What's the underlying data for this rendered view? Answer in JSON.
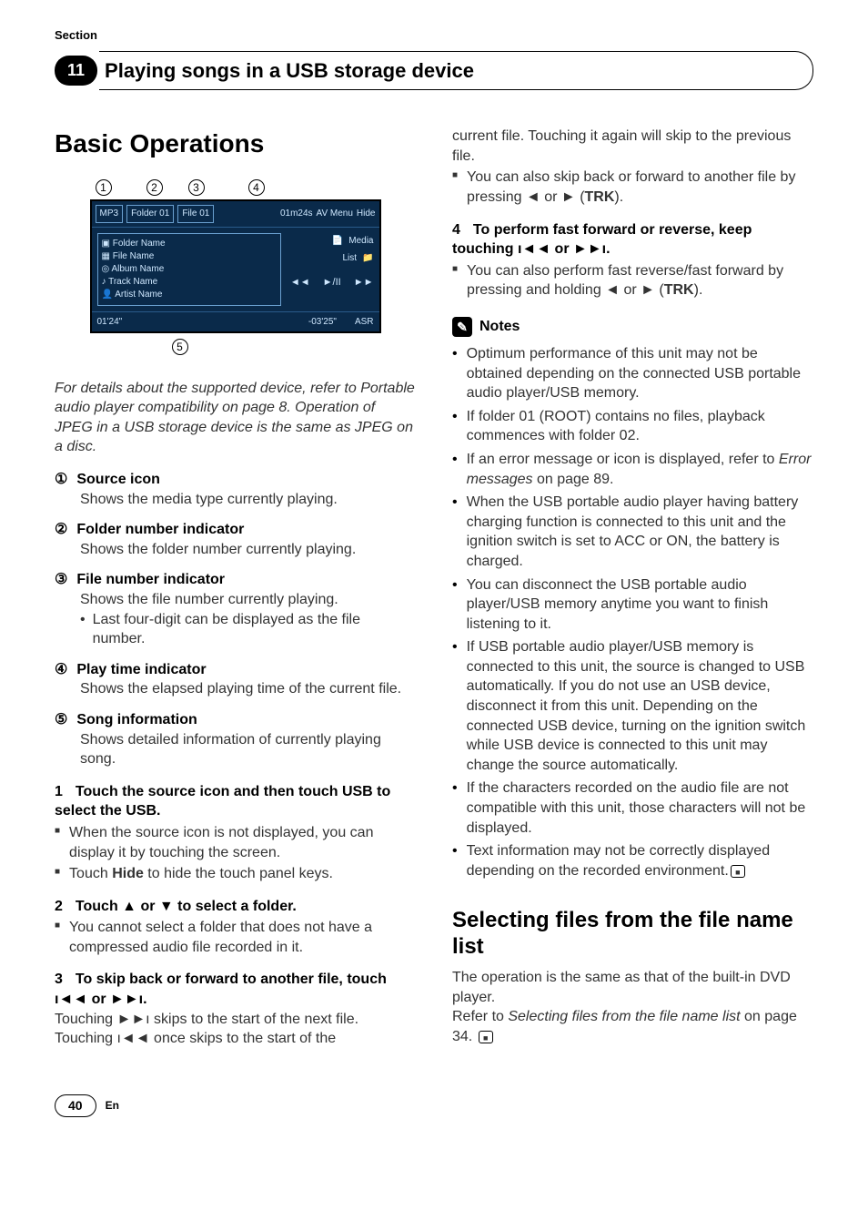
{
  "header": {
    "section_label": "Section",
    "chapter_number": "11",
    "chapter_title": "Playing songs in a USB storage device"
  },
  "left": {
    "h1": "Basic Operations",
    "screenshot": {
      "callouts_top": [
        "1",
        "2",
        "3",
        "4"
      ],
      "callouts_bottom": "5",
      "top_mp3": "MP3",
      "top_folder": "Folder 01",
      "top_file": "File 01",
      "top_time": "01m24s",
      "top_av": "AV Menu",
      "top_hide": "Hide",
      "info_folder": "Folder Name",
      "info_file": "File Name",
      "info_album": "Album Name",
      "info_track": "Track Name",
      "info_artist": "Artist Name",
      "side_media": "Media",
      "side_list": "List",
      "icon_prev": "◄◄",
      "icon_play": "►/II",
      "icon_next": "►►",
      "bot_left": "01'24\"",
      "bot_mid": "-03'25\"",
      "bot_asr": "ASR"
    },
    "italic_note": "For details about the supported device, refer to Portable audio player compatibility on page 8. Operation of JPEG in a USB storage device is the same as JPEG on a disc.",
    "defs": [
      {
        "num": "①",
        "title": "Source icon",
        "body": "Shows the media type currently playing."
      },
      {
        "num": "②",
        "title": "Folder number indicator",
        "body": "Shows the folder number currently playing."
      },
      {
        "num": "③",
        "title": "File number indicator",
        "body": "Shows the file number currently playing.",
        "bullet": "Last four-digit can be displayed as the file number."
      },
      {
        "num": "④",
        "title": "Play time indicator",
        "body": "Shows the elapsed playing time of the current file."
      },
      {
        "num": "⑤",
        "title": "Song information",
        "body": "Shows detailed information of currently playing song."
      }
    ],
    "steps": {
      "s1_head": "Touch the source icon and then touch USB to select the USB.",
      "s1_n1": "When the source icon is not displayed, you can display it by touching the screen.",
      "s1_n2_a": "Touch ",
      "s1_n2_b": "Hide",
      "s1_n2_c": " to hide the touch panel keys.",
      "s2_head": "Touch ▲ or ▼ to select a folder.",
      "s2_n1": "You cannot select a folder that does not have a compressed audio file recorded in it.",
      "s3_head": "To skip back or forward to another file, touch ı◄◄ or ►►ı.",
      "s3_b1": "Touching ►►ı skips to the start of the next file. Touching ı◄◄ once skips to the start of the"
    }
  },
  "right": {
    "cont": "current file. Touching it again will skip to the previous file.",
    "cont_note_a": "You can also skip back or forward to another file by pressing ◄ or ► (",
    "cont_note_b": "TRK",
    "cont_note_c": ").",
    "s4_head": "To perform fast forward or reverse, keep touching ı◄◄ or ►►ı.",
    "s4_n1_a": "You can also perform fast reverse/fast forward by pressing and holding ◄ or ► (",
    "s4_n1_b": "TRK",
    "s4_n1_c": ").",
    "notes_label": "Notes",
    "notes": [
      "Optimum performance of this unit may not be obtained depending on the connected USB portable audio player/USB memory.",
      "If folder 01 (ROOT) contains no files, playback commences with folder 02.",
      "If an error message or icon is displayed, refer to Error messages on page 89.",
      "When the USB portable audio player having battery charging function is connected to this unit and the ignition switch is set to ACC or ON, the battery is charged.",
      "You can disconnect the USB portable audio player/USB memory anytime you want to finish listening to it.",
      "If USB portable audio player/USB memory is connected to this unit, the source is changed to USB automatically. If you do not use an USB device, disconnect it from this unit. Depending on the connected USB device, turning on the ignition switch while USB device is connected to this unit may change the source automatically.",
      "If the characters recorded on the audio file are not compatible with this unit, those characters will not be displayed.",
      "Text information may not be correctly displayed depending on the recorded environment."
    ],
    "h2": "Selecting files from the file name list",
    "p1": "The operation is the same as that of the built-in DVD player.",
    "p2_a": "Refer to ",
    "p2_b": "Selecting files from the file name list",
    "p2_c": " on page 34."
  },
  "footer": {
    "page": "40",
    "lang": "En"
  }
}
